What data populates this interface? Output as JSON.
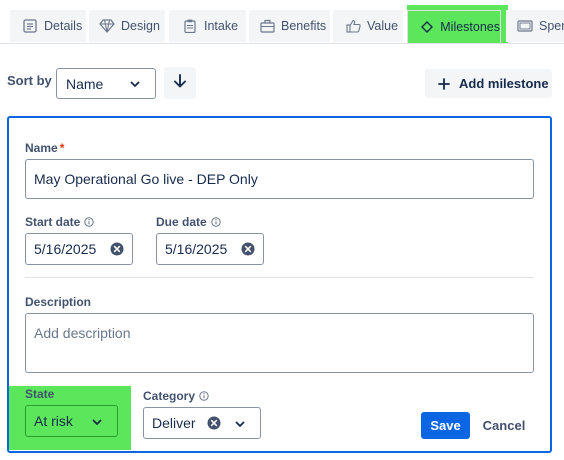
{
  "tabs": [
    {
      "label": "Details",
      "icon": "details-icon"
    },
    {
      "label": "Design",
      "icon": "diamond-icon"
    },
    {
      "label": "Intake",
      "icon": "clipboard-icon"
    },
    {
      "label": "Benefits",
      "icon": "gift-icon"
    },
    {
      "label": "Value",
      "icon": "thumbs-up-icon"
    },
    {
      "label": "Milestones",
      "icon": "milestone-diamond-icon",
      "active": true
    },
    {
      "label": "Spend",
      "icon": "spend-icon"
    }
  ],
  "sort": {
    "label": "Sort by",
    "value": "Name",
    "direction": "descending"
  },
  "add_milestone_label": "Add milestone",
  "form": {
    "name_label": "Name",
    "required_mark": "*",
    "name_value": "May Operational Go live - DEP Only",
    "start_date_label": "Start date",
    "start_date_value": "5/16/2025",
    "due_date_label": "Due date",
    "due_date_value": "5/16/2025",
    "description_label": "Description",
    "description_placeholder": "Add description",
    "state_label": "State",
    "state_value": "At risk",
    "category_label": "Category",
    "category_value": "Deliver",
    "save_label": "Save",
    "cancel_label": "Cancel"
  },
  "colors": {
    "accent": "#0c66e4",
    "highlight": "#5ce65c",
    "required": "#de350b"
  }
}
